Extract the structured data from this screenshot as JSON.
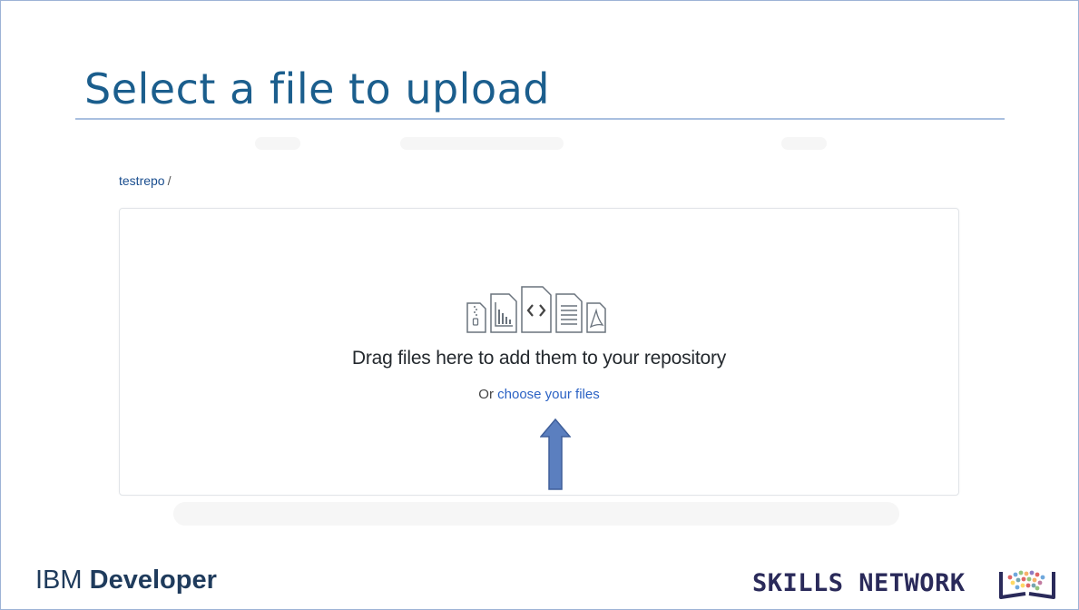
{
  "slide": {
    "title": "Select a file to upload"
  },
  "breadcrumb": {
    "repo": "testrepo",
    "separator": "/"
  },
  "dropzone": {
    "icons": [
      "zip-file-icon",
      "chart-file-icon",
      "code-file-icon",
      "text-file-icon",
      "pdf-file-icon"
    ],
    "heading": "Drag files here to add them to your repository",
    "choose_prefix": "Or ",
    "choose_link": "choose your files"
  },
  "annotation": {
    "arrow": "up-arrow-icon",
    "color": "#5b7fbf"
  },
  "footer": {
    "ibm_light": "IBM ",
    "ibm_bold": "Developer",
    "skills_network": "SKILLS NETWORK",
    "skills_logo": "skills-network-logo"
  },
  "colors": {
    "title": "#1b5e8d",
    "link": "#2b62c4",
    "rule": "#a9bfe0"
  }
}
